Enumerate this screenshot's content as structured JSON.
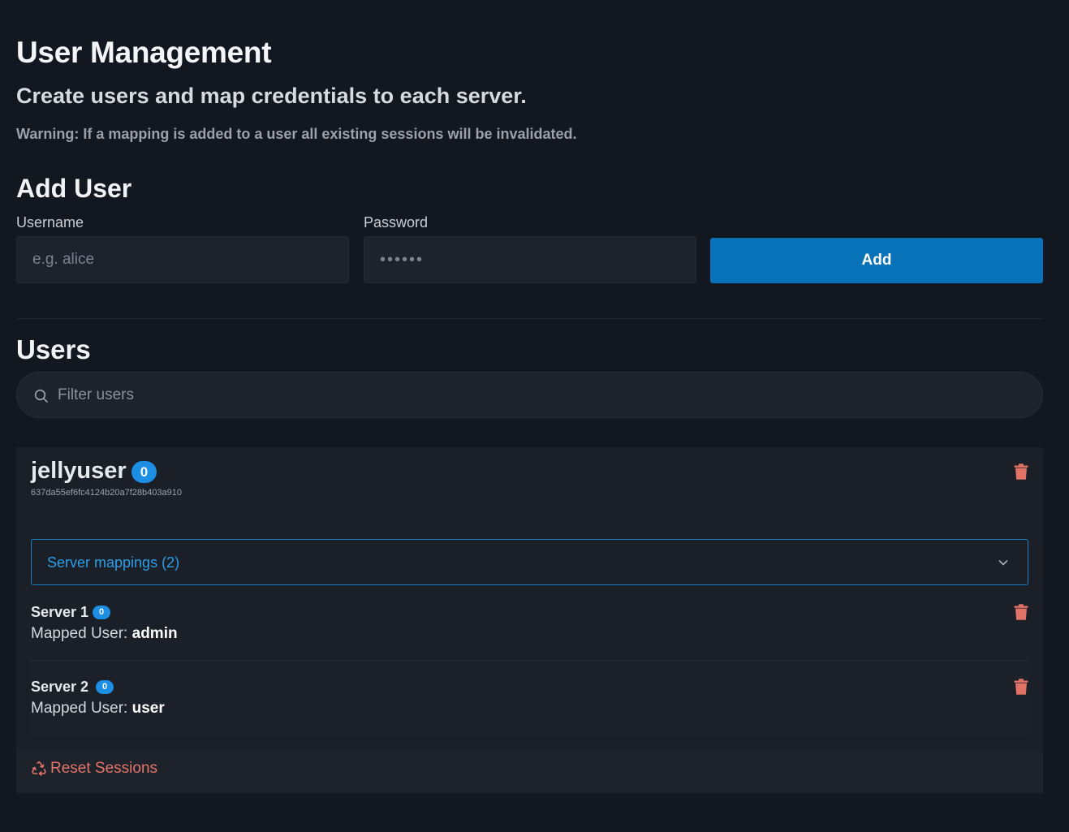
{
  "header": {
    "title": "User Management",
    "subtitle": "Create users and map credentials to each server.",
    "warning": "Warning: If a mapping is added to a user all existing sessions will be invalidated."
  },
  "add_user": {
    "title": "Add User",
    "username_label": "Username",
    "username_placeholder": "e.g. alice",
    "password_label": "Password",
    "password_placeholder": "••••••",
    "add_button_label": "Add"
  },
  "users": {
    "title": "Users",
    "filter_placeholder": "Filter users",
    "list": [
      {
        "name": "jellyuser",
        "badge": "0",
        "id": "637da55ef6fc4124b20a7f28b403a910",
        "mappings_label": "Server mappings (2)",
        "mappings": [
          {
            "server": "Server 1",
            "badge": "0",
            "mapped_prefix": "Mapped User:",
            "mapped_user": "admin"
          },
          {
            "server": "Server 2",
            "badge": "0",
            "mapped_prefix": "Mapped User:",
            "mapped_user": "user"
          }
        ],
        "reset_label": "Reset Sessions"
      }
    ]
  },
  "icons": {
    "search": "search-icon",
    "trash": "trash-icon",
    "chevron": "chevron-down-icon",
    "recycle": "recycle-icon"
  },
  "colors": {
    "background": "#13171f",
    "accent": "#0772b8",
    "badge": "#1c8ee3",
    "danger": "#e27569",
    "link": "#2d9de6"
  }
}
